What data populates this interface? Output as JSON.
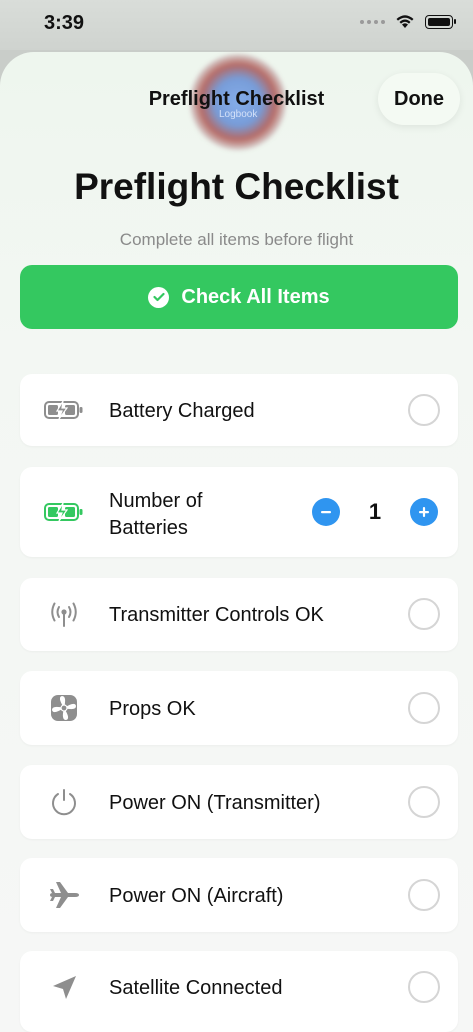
{
  "status_bar": {
    "time": "3:39"
  },
  "nav": {
    "title": "Preflight Checklist",
    "done_label": "Done",
    "logo_text": "Logbook"
  },
  "header": {
    "title": "Preflight Checklist",
    "subtitle": "Complete all items before flight"
  },
  "check_all": {
    "label": "Check All Items",
    "color": "#34c860"
  },
  "items": [
    {
      "label": "Battery Charged",
      "icon": "battery-charging-icon",
      "checked": false
    },
    {
      "label_line1": "Number of",
      "label_line2": "Batteries",
      "icon": "battery-charging-green-icon",
      "value": "1"
    },
    {
      "label": "Transmitter Controls OK",
      "icon": "antenna-icon",
      "checked": false
    },
    {
      "label": "Props OK",
      "icon": "fan-icon",
      "checked": false
    },
    {
      "label": "Power ON (Transmitter)",
      "icon": "power-icon",
      "checked": false
    },
    {
      "label": "Power ON (Aircraft)",
      "icon": "airplane-icon",
      "checked": false
    },
    {
      "label": "Satellite Connected",
      "icon": "location-arrow-icon",
      "checked": false
    }
  ],
  "colors": {
    "accent_blue": "#2f95f0",
    "accent_green": "#34c860"
  }
}
